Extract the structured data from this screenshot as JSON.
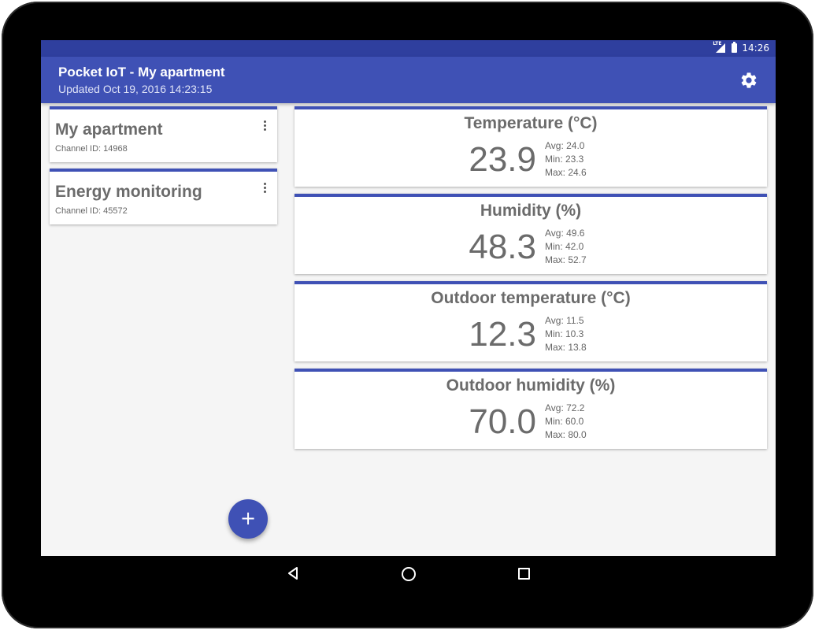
{
  "status_bar": {
    "network": "LTE",
    "time": "14:26"
  },
  "app_bar": {
    "title": "Pocket IoT - My apartment",
    "subtitle": "Updated Oct 19, 2016 14:23:15",
    "settings_icon": "gear-icon"
  },
  "channels": [
    {
      "name": "My apartment",
      "channel_id": "Channel ID: 14968"
    },
    {
      "name": "Energy monitoring",
      "channel_id": "Channel ID: 45572"
    }
  ],
  "sensors": [
    {
      "title": "Temperature (°C)",
      "value": "23.9",
      "avg": "Avg: 24.0",
      "min": "Min: 23.3",
      "max": "Max: 24.6"
    },
    {
      "title": "Humidity (%)",
      "value": "48.3",
      "avg": "Avg: 49.6",
      "min": "Min: 42.0",
      "max": "Max: 52.7"
    },
    {
      "title": "Outdoor temperature (°C)",
      "value": "12.3",
      "avg": "Avg: 11.5",
      "min": "Min: 10.3",
      "max": "Max: 13.8"
    },
    {
      "title": "Outdoor humidity (%)",
      "value": "70.0",
      "avg": "Avg: 72.2",
      "min": "Min: 60.0",
      "max": "Max: 80.0"
    }
  ],
  "fab": {
    "label": "+"
  },
  "colors": {
    "primary": "#3f51b5",
    "primary_dark": "#2f3f9e",
    "background": "#f5f5f5"
  }
}
